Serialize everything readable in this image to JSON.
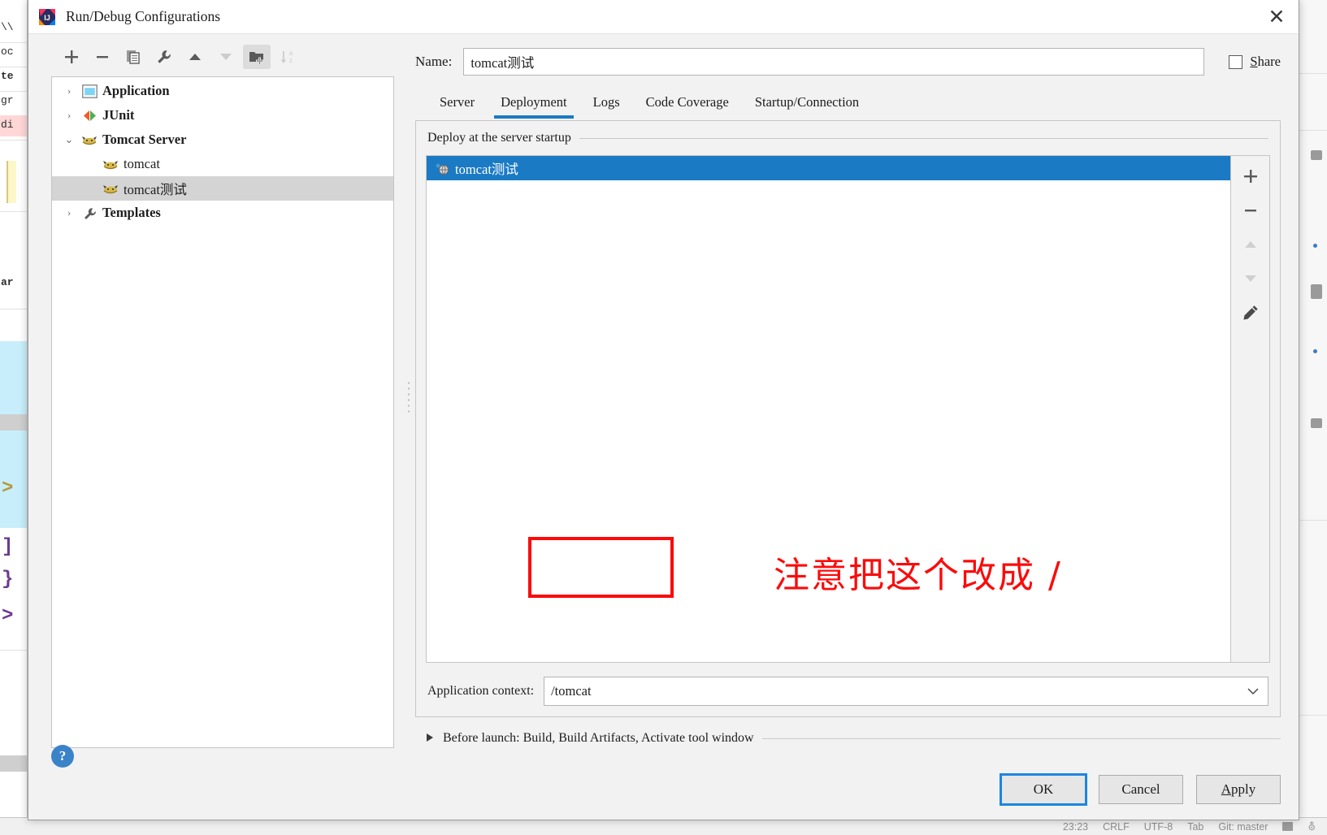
{
  "dialog": {
    "title": "Run/Debug Configurations",
    "app_icon": "intellij-idea-icon",
    "close_icon": "✕"
  },
  "tree_toolbar": {
    "buttons": [
      {
        "name": "add-configuration-button",
        "glyph": "+",
        "state": "enabled"
      },
      {
        "name": "remove-configuration-button",
        "glyph": "−",
        "state": "enabled"
      },
      {
        "name": "copy-configuration-button",
        "glyph": "copy",
        "state": "enabled"
      },
      {
        "name": "edit-templates-button",
        "glyph": "wrench",
        "state": "enabled"
      },
      {
        "name": "move-up-button",
        "glyph": "▲",
        "state": "enabled"
      },
      {
        "name": "move-down-button",
        "glyph": "▼",
        "state": "disabled"
      },
      {
        "name": "create-folder-button",
        "glyph": "folder-plus",
        "state": "active"
      },
      {
        "name": "sort-configurations-button",
        "glyph": "sort-az",
        "state": "disabled"
      }
    ]
  },
  "tree": {
    "items": [
      {
        "label": "Application",
        "arrow": "›",
        "icon": "application-icon",
        "bold": true,
        "child": false,
        "selected": false
      },
      {
        "label": "JUnit",
        "arrow": "›",
        "icon": "junit-icon",
        "bold": true,
        "child": false,
        "selected": false
      },
      {
        "label": "Tomcat Server",
        "arrow": "⌄",
        "icon": "tomcat-icon",
        "bold": true,
        "child": false,
        "selected": false
      },
      {
        "label": "tomcat",
        "arrow": "",
        "icon": "tomcat-icon",
        "bold": false,
        "child": true,
        "selected": false
      },
      {
        "label": "tomcat测试",
        "arrow": "",
        "icon": "tomcat-icon",
        "bold": false,
        "child": true,
        "selected": true
      },
      {
        "label": "Templates",
        "arrow": "›",
        "icon": "templates-icon",
        "bold": true,
        "child": false,
        "selected": false
      }
    ]
  },
  "name_row": {
    "label": "Name:",
    "value": "tomcat测试",
    "placeholder": "",
    "share_label_underlined": "S",
    "share_label_rest": "hare",
    "share_checked": false
  },
  "tabs": [
    {
      "label": "Server",
      "active": false
    },
    {
      "label": "Deployment",
      "active": true
    },
    {
      "label": "Logs",
      "active": false
    },
    {
      "label": "Code Coverage",
      "active": false
    },
    {
      "label": "Startup/Connection",
      "active": false
    }
  ],
  "deployment": {
    "group_title": "Deploy at the server startup",
    "artifacts": [
      {
        "label": "tomcat测试",
        "icon": "artifact-icon",
        "selected": true
      }
    ],
    "side_toolbar": [
      {
        "name": "add-artifact-button",
        "glyph": "+",
        "state": "enabled"
      },
      {
        "name": "remove-artifact-button",
        "glyph": "−",
        "state": "enabled"
      },
      {
        "name": "move-artifact-up-button",
        "glyph": "▲",
        "state": "disabled"
      },
      {
        "name": "move-artifact-down-button",
        "glyph": "▼",
        "state": "disabled"
      },
      {
        "name": "edit-artifact-button",
        "glyph": "pencil",
        "state": "enabled"
      }
    ],
    "context_label": "Application context:",
    "context_value": "/tomcat",
    "context_placeholder": ""
  },
  "annotation": {
    "text": "注意把这个改成 /",
    "color": "#fb0b0b",
    "box_target": "application-context-input"
  },
  "before_launch": {
    "arrow": "▶",
    "text": "Before launch: Build, Build Artifacts, Activate tool window"
  },
  "buttons": {
    "ok": "OK",
    "cancel": "Cancel",
    "apply_underlined": "A",
    "apply_rest": "pply",
    "help": "?"
  },
  "background": {
    "status_bar": [
      "23:23",
      "CRLF",
      "UTF-8",
      "Tab",
      "Git: master"
    ]
  },
  "colors": {
    "accent_blue": "#1b7ac4",
    "focus_blue": "#1b86e0",
    "annotation_red": "#fb0b0b",
    "selection_gray": "#d4d4d4",
    "dialog_bg": "#f2f2f2"
  }
}
